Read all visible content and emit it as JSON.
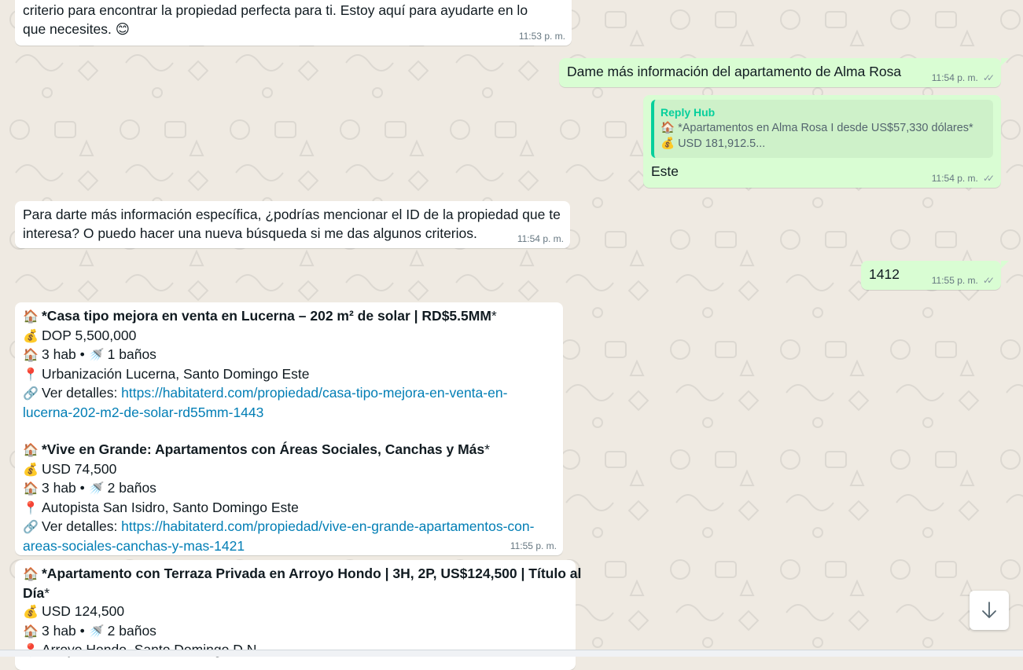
{
  "messages": {
    "m1": {
      "text": "criterio para encontrar la propiedad perfecta para ti. Estoy aquí para ayudarte en lo",
      "text2": "que necesites. 😊",
      "time": "11:53 p. m."
    },
    "m2": {
      "text": "Dame más información del apartamento de Alma Rosa",
      "time": "11:54 p. m."
    },
    "m3": {
      "quote_author": "Reply Hub",
      "quote_line1": "🏠 *Apartamentos en Alma Rosa I desde US$57,330 dólares*",
      "quote_line2": "💰 USD 181,912.5...",
      "text": "Este",
      "time": "11:54 p. m."
    },
    "m4": {
      "text1": "Para darte más información específica, ¿podrías mencionar el ID de la propiedad que te",
      "text2": "interesa? O puedo hacer una nueva búsqueda si me das algunos criterios.",
      "time": "11:54 p. m."
    },
    "m5": {
      "text": "1412",
      "time": "11:55 p. m."
    },
    "m6": {
      "p1_title": "*Casa tipo mejora en venta en Lucerna – 202 m² de solar | RD$5.5MM",
      "p1_title_end": "*",
      "p1_price": "DOP 5,500,000",
      "p1_rooms": "3 hab • ",
      "p1_baths": "1 baños",
      "p1_location": "Urbanización Lucerna, Santo Domingo Este",
      "p1_details_label": "Ver detalles: ",
      "p1_link1": "https://habitaterd.com/propiedad/casa-tipo-mejora-en-venta-en-",
      "p1_link2": "lucerna-202-m2-de-solar-rd55mm-1443",
      "p2_title": "*Vive en Grande: Apartamentos con Áreas Sociales, Canchas y Más",
      "p2_title_end": "*",
      "p2_price": "USD 74,500",
      "p2_rooms": "3 hab • ",
      "p2_baths": "2 baños",
      "p2_location": "Autopista San Isidro, Santo Domingo Este",
      "p2_details_label": "Ver detalles: ",
      "p2_link1": "https://habitaterd.com/propiedad/vive-en-grande-apartamentos-con-",
      "p2_link2": "areas-sociales-canchas-y-mas-1421",
      "time": "11:55 p. m."
    },
    "m7": {
      "p3_title1": "*Apartamento con Terraza Privada en Arroyo Hondo | 3H, 2P, US$124,500 | Título al",
      "p3_title2": "Día",
      "p3_title_end": "*",
      "p3_price": "USD 124,500",
      "p3_rooms": "3 hab • ",
      "p3_baths": "2 baños",
      "p3_location": "Arroyo Hondo, Santo Domingo D.N."
    }
  },
  "icons": {
    "house": "🏠",
    "money": "💰",
    "bath": "🚿",
    "pin": "📍",
    "link": "🔗",
    "ticks": "✓✓"
  },
  "colors": {
    "background": "#efeae2",
    "incoming": "#ffffff",
    "outgoing": "#d9fdd3",
    "link": "#027eb5",
    "quote_accent": "#06cf9c"
  }
}
